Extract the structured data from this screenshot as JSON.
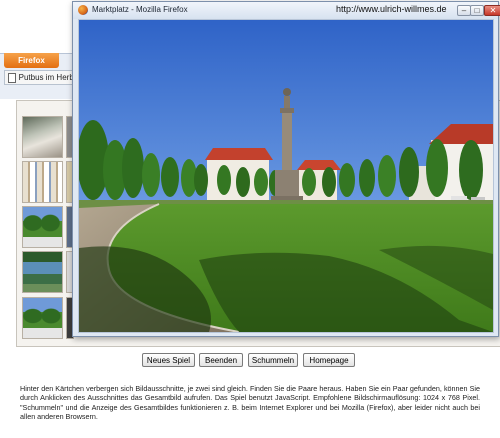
{
  "background_window": {
    "firefox_button_label": "Firefox",
    "tab_label": "Putbus im Herbst"
  },
  "popup": {
    "title": "Marktplatz - Mozilla Firefox",
    "url": "http://www.ulrich-willmes.de",
    "image_description": "Photo of Putbus market square with monument, trees and green lawn"
  },
  "controls": {
    "new_game": "Neues Spiel",
    "end": "Beenden",
    "shuffle": "Schummeln",
    "homepage": "Homepage"
  },
  "instructions": "Hinter den Kärtchen verbergen sich Bildausschnitte, je zwei sind gleich. Finden Sie die Paare heraus. Haben Sie ein Paar gefunden, können Sie durch Anklicken des Ausschnittes das Gesamtbild aufrufen. Das Spiel benutzt JavaScript. Empfohlene Bildschirmauflösung: 1024 x 768 Pixel. \"Schummeln\" und die Anzeige des Gesamtbildes funktionieren z. B. beim Internet Explorer und bei Mozilla (Firefox), aber leider nicht auch bei allen anderen Browsern.",
  "icons": {
    "firefox_logo": "firefox-logo-icon",
    "minimize": "minimize-icon",
    "maximize": "maximize-icon",
    "close": "close-icon"
  }
}
